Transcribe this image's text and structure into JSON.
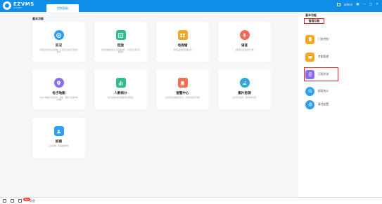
{
  "app": {
    "name": "EZVMS",
    "subtitle": "SYSTEM",
    "tab": "控制面板",
    "user": "admin"
  },
  "main": {
    "section_title": "基本功能",
    "cards": [
      {
        "title": "实况",
        "desc": "查看监控点的实时画面，以监控点进行实况监控操作",
        "color": "#2f9df4",
        "icon": "camera-icon"
      },
      {
        "title": "回放",
        "desc": "搜索并播放监控点的录像文件，以监控点进行回放操作",
        "color": "#2bbf8a",
        "icon": "playback-icon"
      },
      {
        "title": "电视墙",
        "desc": "添加设备并配置电视墙",
        "color": "#f5a623",
        "icon": "tv-wall-icon"
      },
      {
        "title": "语音",
        "desc": "选择语音设备进行广播",
        "color": "#f36b57",
        "icon": "microphone-icon"
      },
      {
        "title": "电子地图",
        "desc": "在电子地图显示监控点，编辑、删除以及使用电子地图",
        "color": "#8a6cf0",
        "icon": "map-pin-icon"
      },
      {
        "title": "人数统计",
        "desc": "统计设备的客流数据并生成报表",
        "color": "#2bbf8a",
        "icon": "bar-chart-icon"
      },
      {
        "title": "报警中心",
        "desc": "实时显示设备报警信息，并进行处理与查询",
        "color": "#f36b57",
        "icon": "alarm-icon"
      },
      {
        "title": "图片检测",
        "desc": "实时显示图片，提供检索功能",
        "color": "#2fa8d8",
        "icon": "image-icon"
      },
      {
        "title": "抓图",
        "desc": "实时抓图，查看截图文件",
        "color": "#2f9df4",
        "icon": "person-card-icon"
      }
    ]
  },
  "side": {
    "heading": "基本功能",
    "subheading": "管理功能",
    "items": [
      {
        "label": "门禁控制",
        "color": "#f5a623",
        "icon": "door-icon"
      },
      {
        "label": "考勤管理",
        "color": "#f5a623",
        "icon": "attendance-icon"
      },
      {
        "label": "可视对讲",
        "color": "#8a6cf0",
        "icon": "intercom-icon"
      },
      {
        "label": "报表统计",
        "color": "#2f9df4",
        "icon": "report-icon"
      },
      {
        "label": "事件配置",
        "color": "#2f9df4",
        "icon": "event-icon"
      }
    ]
  },
  "bottom": {
    "badge": "99+",
    "label": "消息"
  }
}
